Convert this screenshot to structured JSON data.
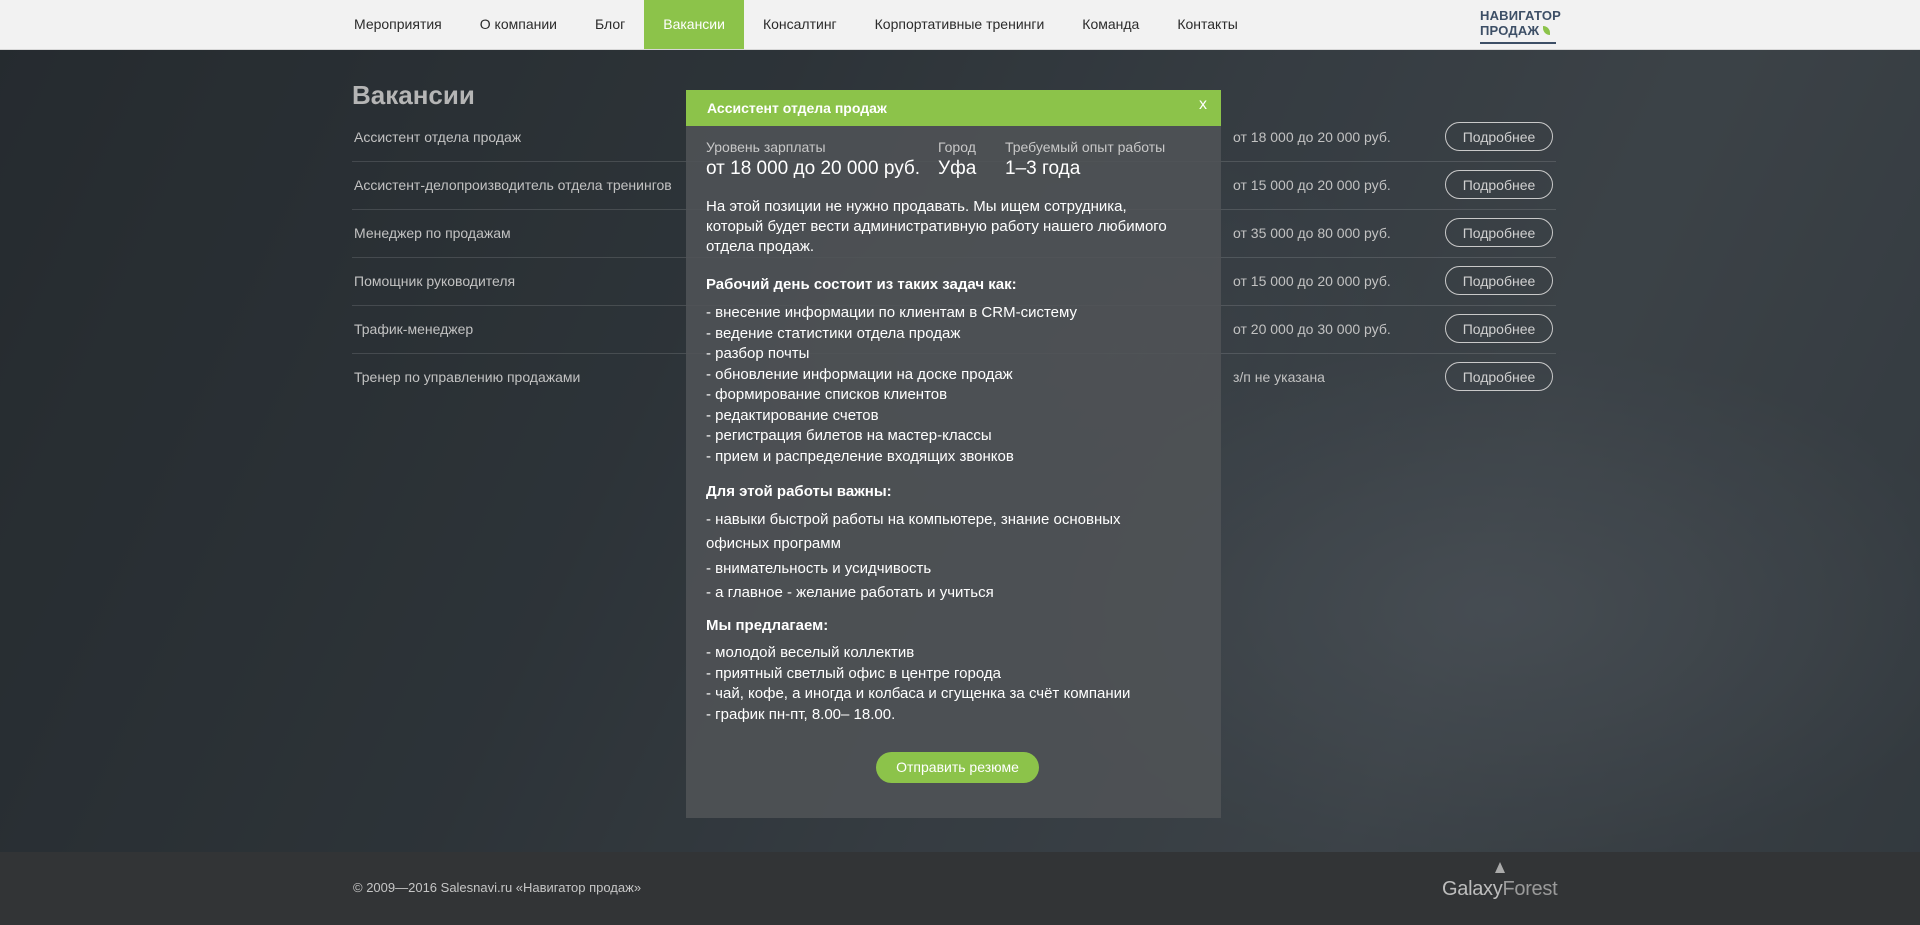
{
  "nav": {
    "items": [
      {
        "label": "Мероприятия"
      },
      {
        "label": "О компании"
      },
      {
        "label": "Блог"
      },
      {
        "label": "Вакансии",
        "active": true
      },
      {
        "label": "Консалтинг"
      },
      {
        "label": "Корпортативные тренинги"
      },
      {
        "label": "Команда"
      },
      {
        "label": "Контакты"
      }
    ],
    "logo_line1": "НАВИГАТОР",
    "logo_line2": "ПРОДАЖ"
  },
  "page": {
    "title": "Вакансии",
    "vacancies": [
      {
        "name": "Ассистент отдела продаж",
        "salary": "от 18 000 до 20 000 руб.",
        "button": "Подробнее"
      },
      {
        "name": "Ассистент-делопроизводитель отдела тренингов",
        "salary": "от 15 000 до 20 000 руб.",
        "button": "Подробнее"
      },
      {
        "name": "Менеджер по продажам",
        "salary": "от 35 000 до 80 000 руб.",
        "button": "Подробнее"
      },
      {
        "name": "Помощник руководителя",
        "salary": "от 15 000 до 20 000 руб.",
        "button": "Подробнее"
      },
      {
        "name": "Трафик-менеджер",
        "salary": "от 20 000 до 30 000 руб.",
        "button": "Подробнее"
      },
      {
        "name": "Тренер по управлению продажами",
        "salary": "з/п не указана",
        "button": "Подробнее"
      }
    ]
  },
  "modal": {
    "title": "Ассистент отдела продаж",
    "close": "x",
    "salary_label": "Уровень зарплаты",
    "salary_value": "от 18 000 до 20 000 руб.",
    "city_label": "Город",
    "city_value": "Уфа",
    "experience_label": "Требуемый опыт работы",
    "experience_value": "1–3 года",
    "intro": "На этой позиции не нужно продавать. Мы ищем сотрудника, который будет вести административную работу нашего любимого отдела продаж.",
    "workday_heading": "Рабочий день состоит из таких задач как:",
    "tasks": [
      "- внесение информации по клиентам в CRM-систему",
      "- ведение статистики отдела продаж",
      "- разбор почты",
      "- обновление информации на доске продаж",
      "- формирование списков клиентов",
      "- редактирование счетов",
      "- регистрация билетов на мастер-классы",
      "- прием и распределение входящих звонков"
    ],
    "requirements_heading": "Для этой работы важны:",
    "requirements": [
      "- навыки быстрой работы на компьютере, знание основных офисных программ",
      "- внимательность и усидчивость",
      "- а главное - желание работать и учиться"
    ],
    "offer_heading": "Мы предлагаем:",
    "offers": [
      "- молодой веселый коллектив",
      "- приятный светлый офис в центре города",
      "- чай, кофе, а иногда и колбаса и сгущенка за счёт компании",
      "- график пн-пт, 8.00– 18.00."
    ],
    "send_button": "Отправить резюме"
  },
  "footer": {
    "copyright": "© 2009—2016 Salesnavi.ru «Навигатор продаж»",
    "brand_part1": "Galaxy",
    "brand_part2": "Forest"
  },
  "colors": {
    "accent": "#8cc34a",
    "footer_bg": "#323436",
    "nav_bg": "#f2f2f2"
  }
}
